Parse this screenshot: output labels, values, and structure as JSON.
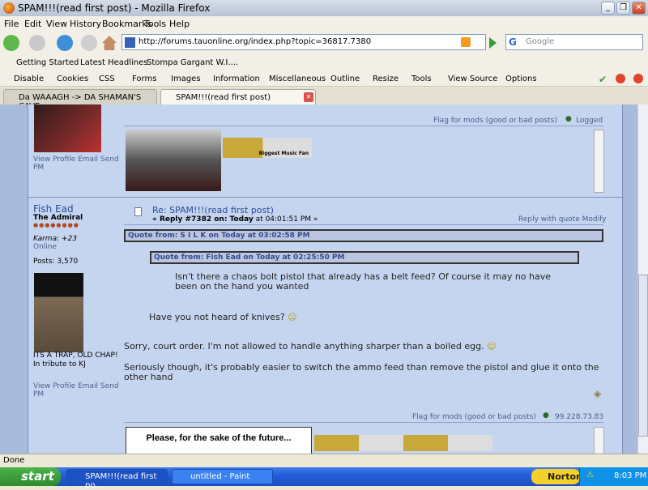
{
  "window": {
    "title": "SPAM!!!(read first post) - Mozilla Firefox"
  },
  "menu": [
    "File",
    "Edit",
    "View",
    "History",
    "Bookmarks",
    "Tools",
    "Help"
  ],
  "nav": {
    "url": "http://forums.tauonline.org/index.php?topic=36817.7380",
    "search_placeholder": "Google"
  },
  "bookmarks": [
    "Getting Started",
    "Latest Headlines",
    "Stompa Gargant W.I...."
  ],
  "devbar": [
    "Disable",
    "Cookies",
    "CSS",
    "Forms",
    "Images",
    "Information",
    "Miscellaneous",
    "Outline",
    "Resize",
    "Tools",
    "View Source",
    "Options"
  ],
  "tabs": [
    {
      "label": "Da WAAAGH -> DA SHAMAN'S CAVE"
    },
    {
      "label": "SPAM!!!(read first post)"
    }
  ],
  "post1": {
    "profile_links": "View Profile Email Send PM",
    "flag": "Flag for mods (good or bad posts)",
    "logged": "Logged",
    "banner_text": "Biggest Music Fan"
  },
  "post2": {
    "author": "Fish Ead",
    "rank": "The Admiral",
    "karma": "Karma: +23",
    "status": "Online",
    "posts": "Posts: 3,570",
    "sig_text1": "ITS A TRAP, OLD CHAP!",
    "sig_text2": "In tribute to KJ",
    "profile_links": "View Profile Email Send PM",
    "title": "Re: SPAM!!!(read first post)",
    "reply_prefix": "« Reply #7382 on: Today",
    "reply_time": "at 04:01:51 PM »",
    "actions": "Reply with quote Modify",
    "quote1_header": "Quote from: S I L K on Today at 03:02:58 PM",
    "quote2_header": "Quote from: Fish Ead on Today at 02:25:50 PM",
    "quote2_body": "Isn't there a chaos bolt pistol that already has a belt feed?  Of course it may no have been on the hand you wanted",
    "quote1_body": "Have you not heard of knives?",
    "body1": "Sorry, court order.  I'm not allowed to handle anything sharper than a boiled egg.",
    "body2": "Seriously though, it's probably easier to switch the ammo feed than remove the pistol and glue it onto the other hand",
    "flag": "Flag for mods (good or bad posts)",
    "ip": "99.228.73.83"
  },
  "post3": {
    "sig_text": "Please, for the sake of the future..."
  },
  "statusbar": {
    "text": "Done"
  },
  "taskbar": {
    "start": "start",
    "tasks": [
      "SPAM!!!(read first po...",
      "untitled - Paint"
    ],
    "norton": "Norton",
    "clock": "8:03 PM"
  }
}
